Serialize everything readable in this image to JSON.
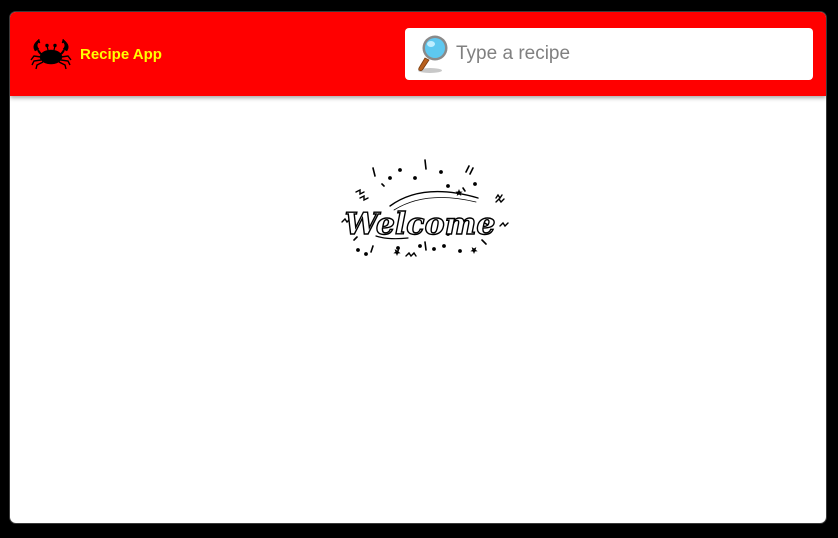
{
  "header": {
    "brand_name": "Recipe App",
    "logo_icon": "crab-icon",
    "background_color": "#ff0000",
    "brand_color": "#ffff00"
  },
  "search": {
    "icon": "magnifier-icon",
    "placeholder": "Type a recipe",
    "value": ""
  },
  "main": {
    "welcome_image_text": "Welcome"
  }
}
